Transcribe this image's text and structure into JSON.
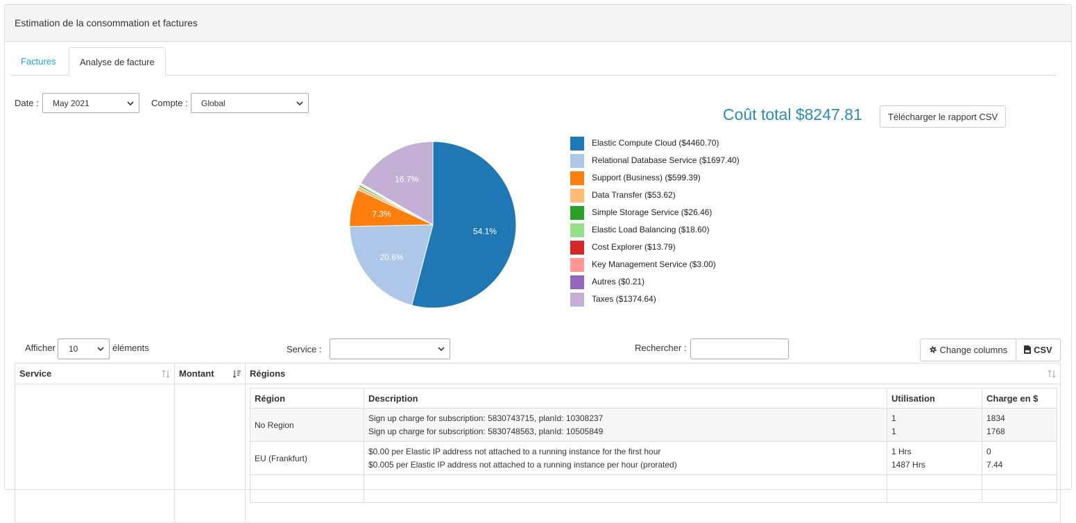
{
  "panel": {
    "title": "Estimation de la consommation et factures"
  },
  "tabs": [
    {
      "label": "Factures",
      "active": false
    },
    {
      "label": "Analyse de facture",
      "active": true
    }
  ],
  "filters": {
    "date_label": "Date :",
    "date_value": "May 2021",
    "account_label": "Compte :",
    "account_value": "Global"
  },
  "summary": {
    "total": "Coût total $8247.81",
    "download_button": "Télécharger le rapport CSV"
  },
  "chart_data": {
    "type": "pie",
    "slices": [
      {
        "name": "Elastic Compute Cloud",
        "value": 4460.7,
        "legend": "Elastic Compute Cloud ($4460.70)",
        "color": "#1f77b4",
        "label": "54.1%"
      },
      {
        "name": "Relational Database Service",
        "value": 1697.4,
        "legend": "Relational Database Service ($1697.40)",
        "color": "#aec7e8",
        "label": "20.6%"
      },
      {
        "name": "Support (Business)",
        "value": 599.39,
        "legend": "Support (Business) ($599.39)",
        "color": "#ff7f0e",
        "label": "7.3%"
      },
      {
        "name": "Data Transfer",
        "value": 53.62,
        "legend": "Data Transfer ($53.62)",
        "color": "#ffbb78",
        "label": ""
      },
      {
        "name": "Simple Storage Service",
        "value": 26.46,
        "legend": "Simple Storage Service ($26.46)",
        "color": "#2ca02c",
        "label": ""
      },
      {
        "name": "Elastic Load Balancing",
        "value": 18.6,
        "legend": "Elastic Load Balancing ($18.60)",
        "color": "#98df8a",
        "label": ""
      },
      {
        "name": "Cost Explorer",
        "value": 13.79,
        "legend": "Cost Explorer ($13.79)",
        "color": "#d62728",
        "label": ""
      },
      {
        "name": "Key Management Service",
        "value": 3.0,
        "legend": "Key Management Service ($3.00)",
        "color": "#ff9896",
        "label": ""
      },
      {
        "name": "Autres",
        "value": 0.21,
        "legend": "Autres ($0.21)",
        "color": "#9467bd",
        "label": ""
      },
      {
        "name": "Taxes",
        "value": 1374.64,
        "legend": "Taxes ($1374.64)",
        "color": "#c5b0d5",
        "label": "16.7%"
      }
    ],
    "legend_placement": "right"
  },
  "table_controls": {
    "show_label": "Afficher",
    "show_value": "10",
    "show_suffix": "éléments",
    "service_label": "Service :",
    "service_value": "",
    "search_label": "Rechercher :",
    "search_value": "",
    "change_columns": "Change columns",
    "csv": "CSV"
  },
  "table": {
    "columns": [
      "Service",
      "Montant",
      "Régions"
    ],
    "inner_columns": [
      "Région",
      "Description",
      "Utilisation",
      "Charge en $"
    ],
    "rows": [
      {
        "region": "No Region",
        "descriptions": [
          "Sign up charge for subscription: 5830743715, planId: 10308237",
          "Sign up charge for subscription: 5830748563, planId: 10505849"
        ],
        "usage": [
          "1",
          "1"
        ],
        "charges": [
          "1834",
          "1768"
        ]
      },
      {
        "region": "EU (Frankfurt)",
        "descriptions": [
          "$0.00 per Elastic IP address not attached to a running instance for the first hour",
          "$0.005 per Elastic IP address not attached to a running instance per hour (prorated)"
        ],
        "usage": [
          "1 Hrs",
          "1487 Hrs"
        ],
        "charges": [
          "0",
          "7.44"
        ]
      }
    ]
  }
}
